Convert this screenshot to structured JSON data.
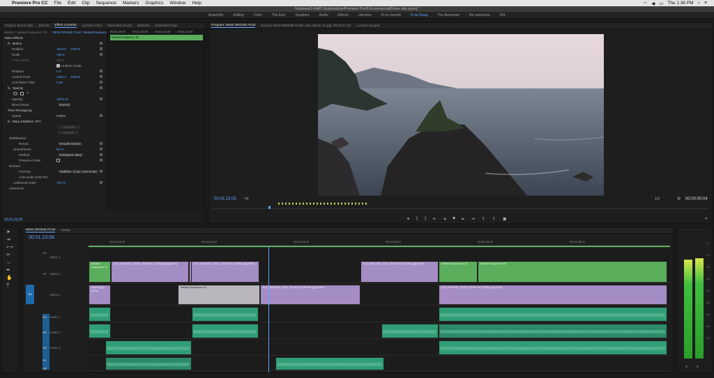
{
  "menubar": {
    "app": "Premiere Pro CC",
    "items": [
      "File",
      "Edit",
      "Clip",
      "Sequence",
      "Markers",
      "Graphics",
      "Window",
      "Help"
    ],
    "clock": "Thu 1:36 PM"
  },
  "titlebar": {
    "path": "/Volumes/G-RAID Studio/adobe/Premiere Pro/8.0/commercial/Drone stitc.prproj *"
  },
  "workspaces": {
    "items": [
      "Assembly",
      "Editing",
      "Color",
      "The Epic",
      "Graphics",
      "Audio",
      "Effects",
      "Libraries",
      "Fi on Garrett",
      "Fi on Doug",
      "The Awesome",
      "the awesome",
      "001"
    ],
    "active_index": 9
  },
  "effect_controls": {
    "tabs": [
      "Project: Drone stric",
      "Effects",
      "Effect Controls",
      "Lumetri Color",
      "Essential Sound",
      "Markers",
      "Essential Grap"
    ],
    "active_tab": 2,
    "source": "Master * Nested Sequence 20",
    "sequence": "NEW DRONE FILM * Nested Sequence 20",
    "timecodes": [
      "00;01;19;00",
      "00;01;20;00",
      "00;01;21;00",
      "00;01;22;00"
    ],
    "clip_bar": "Nested Sequence 20",
    "video_effects_label": "Video Effects",
    "motion": "Motion",
    "position_label": "Position",
    "position_x": "1920.0",
    "position_y": "1080.0",
    "scale_label": "Scale",
    "scale": "100.0",
    "scale_width_label": "Scale Width",
    "scale_width": "100.0",
    "uniform_scale": "Uniform Scale",
    "rotation_label": "Rotation",
    "rotation": "0.0",
    "anchor_label": "Anchor Point",
    "anchor_x": "1920.0",
    "anchor_y": "1080.0",
    "antiflicker_label": "Anti-flicker Filter",
    "antiflicker": "0.00",
    "opacity_label": "Opacity",
    "opacity_value_label": "Opacity",
    "opacity": "100.0 %",
    "blend_label": "Blend Mode",
    "blend": "Normal",
    "time_remap": "Time Remapping",
    "speed_label": "Speed",
    "speed": "0.00%",
    "warp": "Warp Stabilizer VFX",
    "analyze": "Analyze",
    "cancel": "Cancel",
    "stabilization": "Stabilization",
    "result_label": "Result",
    "result": "Smooth Motion",
    "smoothness_label": "Smoothness",
    "smoothness": "50 %",
    "method_label": "Method",
    "method": "Subspace Warp",
    "preserve_label": "Preserve Scale",
    "borders": "Borders",
    "framing_label": "Framing",
    "framing": "Stabilize, Crop, Auto-scale",
    "autoscale_label": "Auto-scale (100.0%)",
    "additional_label": "Additional Scale",
    "additional": "100 %",
    "advanced": "Advanced",
    "bottom_timecode": "00;01;23;05"
  },
  "program": {
    "tabs": [
      "Program: NEW DRONE FILM",
      "Source: NEW DRONE FILM: 18m 45mm 01.jpg: 00;00;17;20",
      "Lumetri Scopes"
    ],
    "timecode": "00;01;23;05",
    "fit": "Fit",
    "ratio": "1/2",
    "duration": "00;00;00;04"
  },
  "timeline": {
    "tab": "NEW DRONE FILM",
    "zoom": "1080p",
    "timecode": "00:01:23:06",
    "ruler": [
      "00;01;14;22",
      "00;01;19;22",
      "00;01;24;21",
      "00;01;29;21",
      "00;01;34;21",
      "00;01;39;21"
    ],
    "tracks_video": [
      "Video 3",
      "Video 2",
      "Video 1"
    ],
    "tracks_audio": [
      "Audio 1",
      "Audio 2",
      "Audio 3"
    ],
    "labels": {
      "v3": "V3",
      "v2": "V2",
      "v1": "V1",
      "a1": "A1",
      "a2": "A2",
      "a3": "A3",
      "a4": "A4",
      "a5": "A5"
    },
    "clips": {
      "c1": "Nested Sequence 19",
      "c2": "DJI_0004-M6_C0490_20160614_0001(K)jpg [40%]",
      "c3": "DJI_0004-M6_C001_20160718_0006K.jpg [40%]",
      "c4": "DJI_0004-M6_C020_20160718_0006K.jpg [40%]",
      "c5": "Nested Sequence 19",
      "c6": "Nested Sequence 19",
      "c7": "Sdw25.jpg [50%]",
      "c8": "Nested Sequence 20",
      "c9": "DJI_0004-M6_C026_20160718_0002K.jpg [40%]",
      "c10": "DJI_0004-M6_C020_20160718_0009K.jpg [40%]"
    }
  },
  "meters": {
    "labels": [
      "S",
      "S"
    ],
    "scale": [
      "-6",
      "-12",
      "-18",
      "-24",
      "-30",
      "-36",
      "-42",
      "-48",
      "-54"
    ]
  },
  "colors": {
    "accent": "#5ea3ff",
    "video_clip": "#a48cc4",
    "nested_clip": "#5bae5b",
    "audio_clip": "#2f9d76"
  }
}
